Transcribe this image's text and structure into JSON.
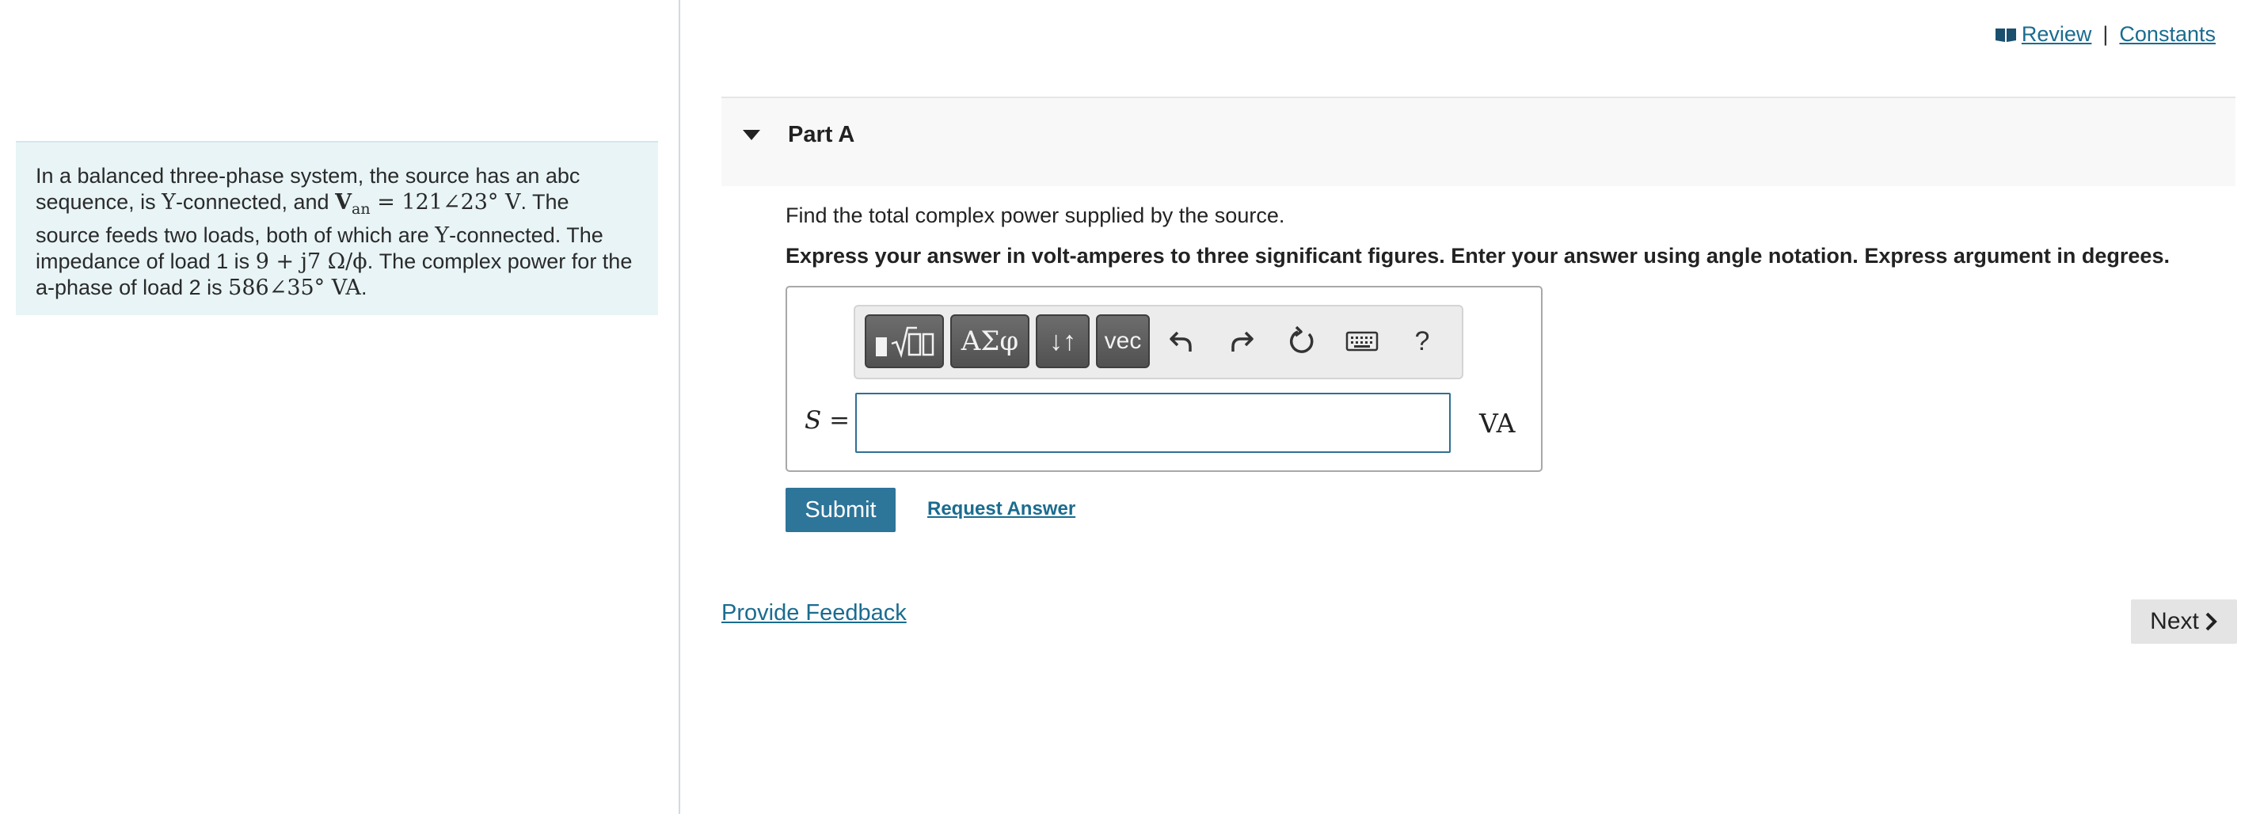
{
  "header": {
    "review_label": "Review",
    "separator": "|",
    "constants_label": "Constants"
  },
  "problem": {
    "t1": "In a balanced three-phase system, the source has an abc sequence, is ",
    "y1": "Y",
    "t2": "-connected, and ",
    "v": "V",
    "v_sub": "an",
    "v_val": " = 121∠23° V",
    "t3": ". The source feeds two loads, both of which are ",
    "y2": "Y",
    "t4": "-connected. The impedance of load 1 is ",
    "z": "9 + j7 Ω/ϕ",
    "t5": ". The complex power for the a-phase of load 2 is ",
    "s2": "586∠35° VA",
    "t6": "."
  },
  "part": {
    "title": "Part A",
    "question": "Find the total complex power supplied by the source.",
    "instructions": "Express your answer in volt-amperes to three significant figures. Enter your answer using angle notation. Express argument in degrees."
  },
  "toolbar": {
    "templates_icon": "matrix-sqrt-icon",
    "greek_label": "ΑΣφ",
    "arrows_label": "↓↑",
    "vec_label": "vec",
    "undo_icon": "undo-icon",
    "redo_icon": "redo-icon",
    "reset_icon": "reset-icon",
    "keyboard_icon": "keyboard-icon",
    "help_label": "?"
  },
  "answer": {
    "variable_label": "S =",
    "value": "",
    "unit": "VA"
  },
  "actions": {
    "submit_label": "Submit",
    "request_label": "Request Answer",
    "feedback_label": "Provide Feedback",
    "next_label": "Next"
  },
  "colors": {
    "link": "#1a6c8f",
    "submit_bg": "#2d7599",
    "problem_bg": "#e8f4f6",
    "input_border": "#2f6f94"
  }
}
